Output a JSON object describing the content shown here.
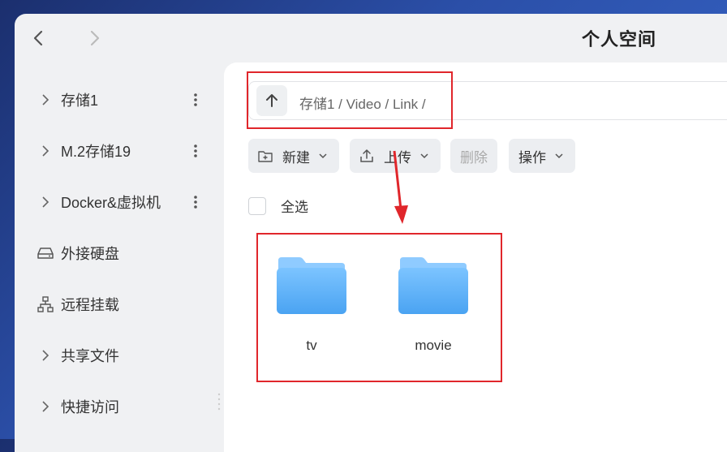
{
  "window": {
    "title": "个人空间"
  },
  "nav": {
    "back_icon": "chevron-left-icon",
    "forward_icon": "chevron-right-icon"
  },
  "sidebar": {
    "items": [
      {
        "label": "存储1",
        "lead": "chevron",
        "more": true
      },
      {
        "label": "M.2存储19",
        "lead": "chevron",
        "more": true
      },
      {
        "label": "Docker&虚拟机",
        "lead": "chevron",
        "more": true
      },
      {
        "label": "外接硬盘",
        "lead": "drive-icon",
        "more": false
      },
      {
        "label": "远程挂载",
        "lead": "network-icon",
        "more": false
      },
      {
        "label": "共享文件",
        "lead": "chevron",
        "more": false
      },
      {
        "label": "快捷访问",
        "lead": "chevron",
        "more": false
      }
    ]
  },
  "path": {
    "text": "存储1 / Video / Link /"
  },
  "toolbar": {
    "new_label": "新建",
    "upload_label": "上传",
    "delete_label": "删除",
    "actions_label": "操作"
  },
  "select_all_label": "全选",
  "files": [
    {
      "name": "tv",
      "type": "folder"
    },
    {
      "name": "movie",
      "type": "folder"
    }
  ],
  "colors": {
    "highlight": "#e0262b",
    "folder": "#5aaef5",
    "accent_bg": "#eceef1"
  }
}
